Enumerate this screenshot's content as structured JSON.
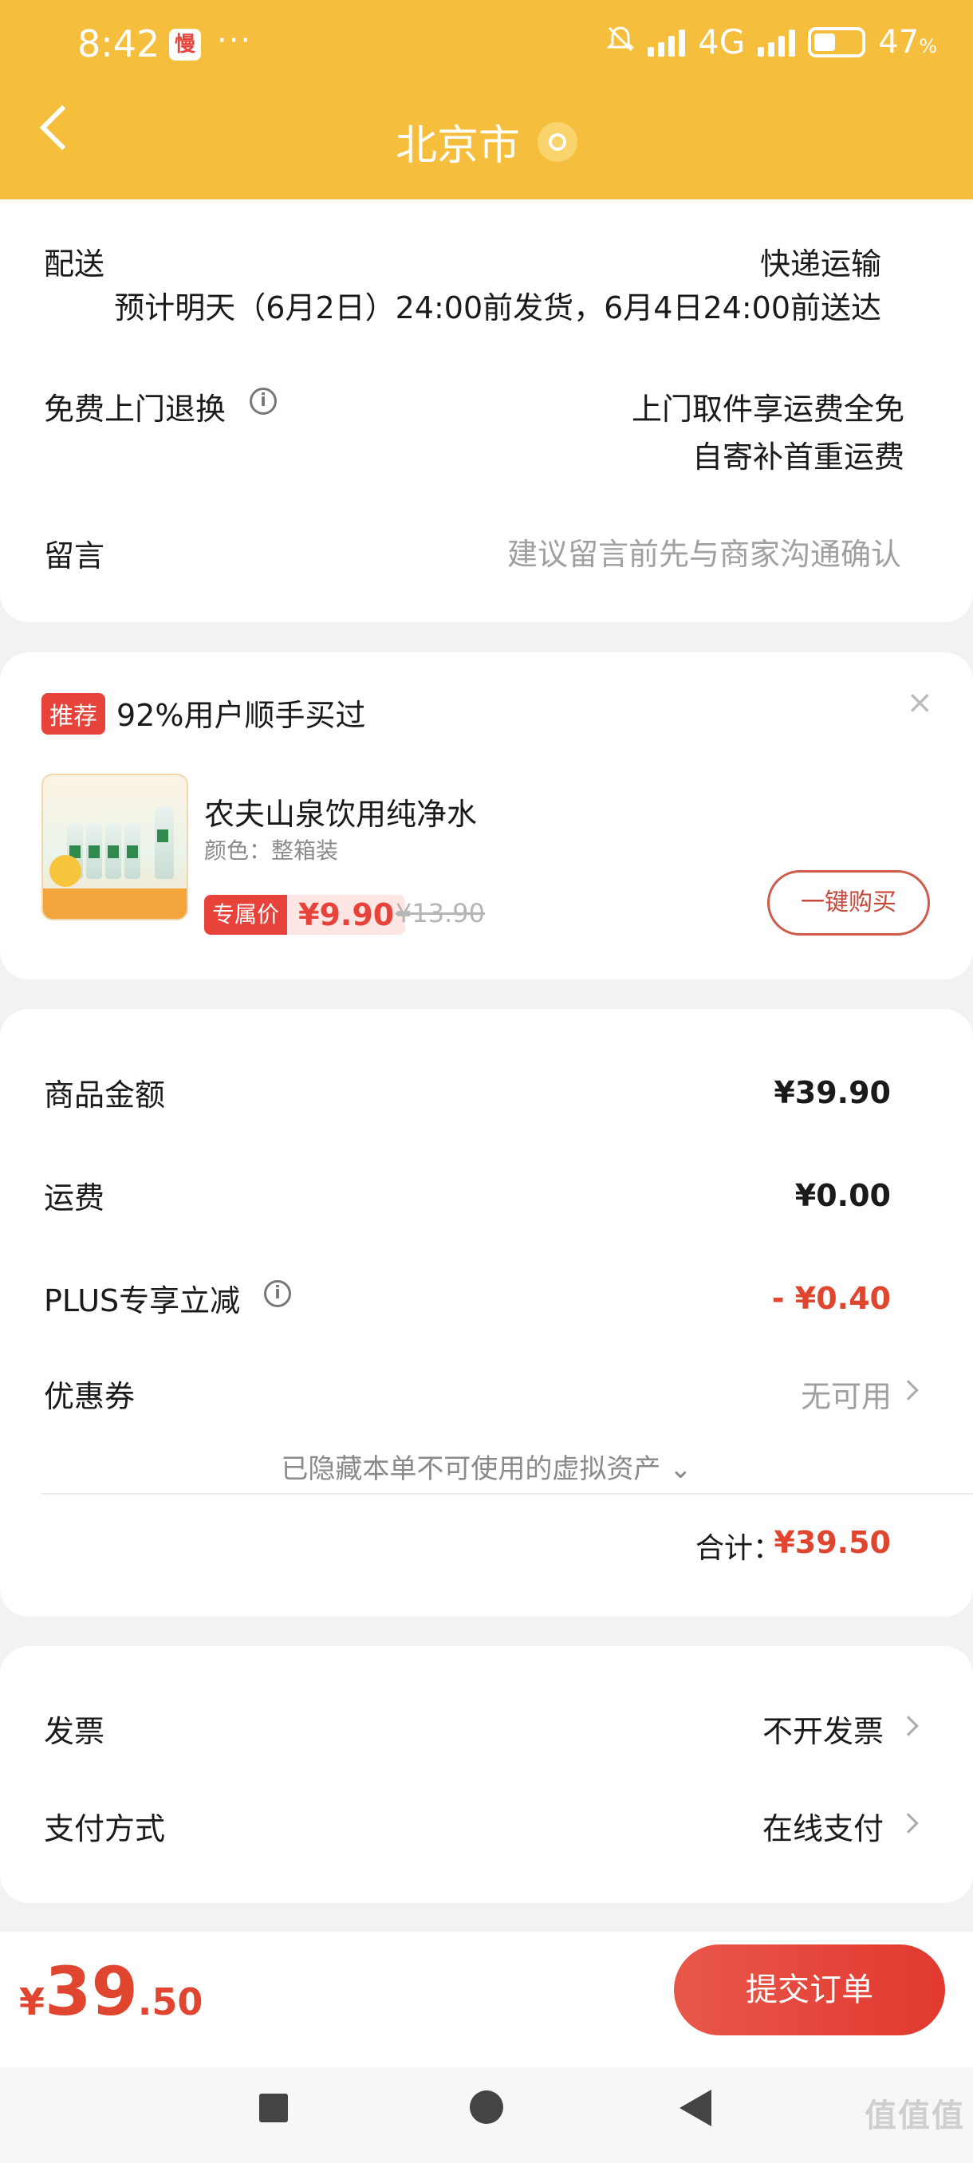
{
  "status_bar": {
    "time": "8:42",
    "app_icon_text": "慢",
    "dots": "···",
    "network": "4G",
    "battery_percent": "47",
    "battery_unit": "%"
  },
  "header": {
    "title": "北京市"
  },
  "delivery": {
    "label": "配送",
    "method": "快递运输",
    "estimate": "预计明天（6月2日）24:00前发货，6月4日24:00前送达",
    "return_label": "免费上门退换",
    "return_line1": "上门取件享运费全免",
    "return_line2": "自寄补首重运费",
    "message_label": "留言",
    "message_placeholder": "建议留言前先与商家沟通确认"
  },
  "recommend": {
    "tag": "推荐",
    "title": "92%用户顺手买过",
    "close": "×",
    "product_name": "农夫山泉饮用纯净水",
    "product_spec": "颜色：整箱装",
    "price_label": "专属价",
    "price": "¥9.90",
    "old_price": "¥13.90",
    "buy_button": "一键购买"
  },
  "summary": {
    "goods_label": "商品金额",
    "goods_value": "¥39.90",
    "shipping_label": "运费",
    "shipping_value": "¥0.00",
    "plus_label": "PLUS专享立减",
    "plus_value": "- ¥0.40",
    "coupon_label": "优惠券",
    "coupon_value": "无可用",
    "hidden_assets": "已隐藏本单不可使用的虚拟资产 ⌄",
    "total_label": "合计：",
    "total_value": "¥39.50"
  },
  "options": {
    "invoice_label": "发票",
    "invoice_value": "不开发票",
    "payment_label": "支付方式",
    "payment_value": "在线支付"
  },
  "footer": {
    "currency": "¥",
    "total_int": "39",
    "total_dec": ".50",
    "submit": "提交订单",
    "watermark": "值值值"
  },
  "colors": {
    "header": "#f5bf3d",
    "accent_red": "#e8433b"
  }
}
